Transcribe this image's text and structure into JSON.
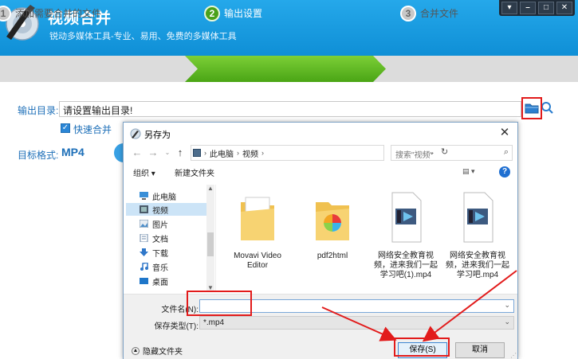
{
  "app": {
    "title": "视频合并",
    "subtitle": "锐动多媒体工具-专业、易用、免费的多媒体工具",
    "window_controls": [
      "▾",
      "–",
      "□",
      "✕"
    ]
  },
  "steps": [
    {
      "num": "1",
      "label": "添加需要合并的文件",
      "active": false
    },
    {
      "num": "2",
      "label": "输出设置",
      "active": true
    },
    {
      "num": "3",
      "label": "合并文件",
      "active": false
    }
  ],
  "form": {
    "output_dir_label": "输出目录:",
    "output_dir_value": "请设置输出目录!",
    "fast_merge_label": "快速合并",
    "fast_merge_checked": true,
    "target_format_label": "目标格式:",
    "target_format_value": "MP4"
  },
  "dialog": {
    "title": "另存为",
    "breadcrumb": [
      "此电脑",
      "视频"
    ],
    "search_placeholder": "搜索\"视频\"",
    "toolbar": {
      "organize": "组织 ▾",
      "new_folder": "新建文件夹"
    },
    "nav_items": [
      {
        "label": "此电脑",
        "icon": "computer-icon",
        "selected": false
      },
      {
        "label": "视频",
        "icon": "video-folder-icon",
        "selected": true
      },
      {
        "label": "图片",
        "icon": "pictures-icon",
        "selected": false
      },
      {
        "label": "文档",
        "icon": "documents-icon",
        "selected": false
      },
      {
        "label": "下载",
        "icon": "downloads-icon",
        "selected": false
      },
      {
        "label": "音乐",
        "icon": "music-icon",
        "selected": false
      },
      {
        "label": "桌面",
        "icon": "desktop-icon",
        "selected": false
      }
    ],
    "files": [
      {
        "name": "Movavi Video Editor",
        "type": "folder"
      },
      {
        "name": "pdf2html",
        "type": "folder-special"
      },
      {
        "name": "网络安全教育视频，进来我们一起学习吧(1).mp4",
        "type": "video"
      },
      {
        "name": "网络安全教育视频，进来我们一起学习吧.mp4",
        "type": "video"
      }
    ],
    "filename_label": "文件名(N):",
    "filename_value": "",
    "filetype_label": "保存类型(T):",
    "filetype_value": "*.mp4",
    "hide_folders_label": "隐藏文件夹",
    "save_label": "保存(S)",
    "cancel_label": "取消"
  },
  "colors": {
    "header_blue": "#1a9be0",
    "step_active_green": "#5ab820",
    "highlight_red": "#e21b1b",
    "label_blue": "#1d6fb8"
  }
}
